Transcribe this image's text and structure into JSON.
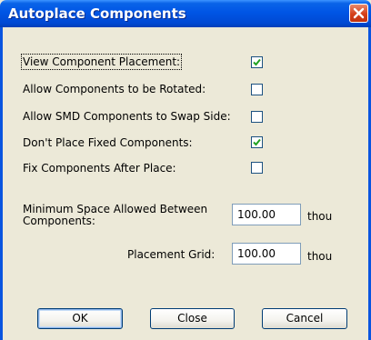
{
  "window": {
    "title": "Autoplace Components"
  },
  "options": [
    {
      "label": "View Component Placement:",
      "checked": true
    },
    {
      "label": "Allow Components to be Rotated:",
      "checked": false
    },
    {
      "label": "Allow SMD Components to Swap Side:",
      "checked": false
    },
    {
      "label": "Don't Place Fixed Components:",
      "checked": true
    },
    {
      "label": "Fix Components After Place:",
      "checked": false
    }
  ],
  "fields": {
    "min_space": {
      "label": "Minimum Space Allowed Between Components:",
      "value": "100.00",
      "unit": "thou"
    },
    "grid": {
      "label": "Placement Grid:",
      "value": "100.00",
      "unit": "thou"
    }
  },
  "buttons": {
    "ok": "OK",
    "close": "Close",
    "cancel": "Cancel"
  },
  "colors": {
    "titlebar": "#0055e5",
    "dialog_bg": "#ece9d8",
    "checkmark": "#21a121",
    "close_button": "#d5401a"
  },
  "icons": {
    "close": "close-x-icon",
    "check": "checkmark-icon"
  }
}
